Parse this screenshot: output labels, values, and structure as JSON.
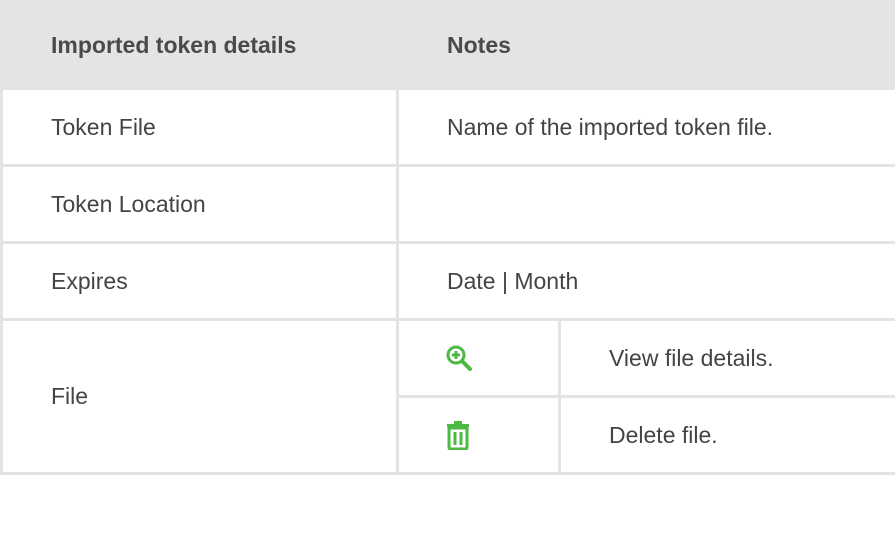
{
  "table": {
    "headers": {
      "details": "Imported token details",
      "notes": "Notes"
    },
    "rows": [
      {
        "label": "Token File",
        "note": "Name of the imported token file."
      },
      {
        "label": "Token Location",
        "note": ""
      },
      {
        "label": "Expires",
        "note": "Date | Month"
      }
    ],
    "file_row": {
      "label": "File",
      "actions": [
        {
          "icon": "zoom-in-icon",
          "description": "View file details."
        },
        {
          "icon": "trash-icon",
          "description": "Delete file."
        }
      ]
    }
  },
  "colors": {
    "header_bg": "#e4e4e4",
    "border": "#e4e4e4",
    "text": "#444444",
    "icon_green": "#4cb944"
  }
}
